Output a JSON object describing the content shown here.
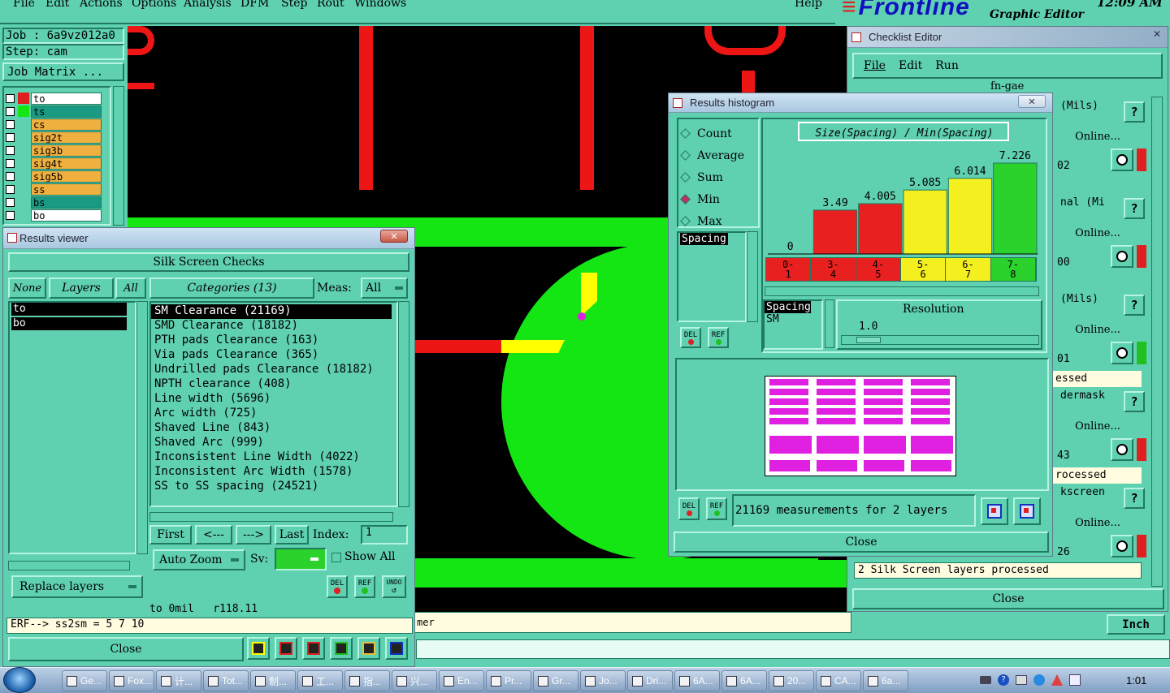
{
  "menubar": {
    "items": [
      "File",
      "Edit",
      "Actions",
      "Options",
      "Analysis",
      "DFM",
      "Step",
      "Rout",
      "Windows"
    ],
    "help": "Help"
  },
  "brand": {
    "name": "Frontline",
    "subtitle": "Graphic Editor",
    "clock": "12:09 AM"
  },
  "job": {
    "job_line": "Job : 6a9vz012a0",
    "step_line": "Step: cam",
    "matrix_button": "Job Matrix ..."
  },
  "layers": [
    {
      "name": "to",
      "color": "#ffffff"
    },
    {
      "name": "ts",
      "color": "#1a9a82"
    },
    {
      "name": "cs",
      "color": "#f0b040"
    },
    {
      "name": "sig2t",
      "color": "#f0b040"
    },
    {
      "name": "sig3b",
      "color": "#f0b040"
    },
    {
      "name": "sig4t",
      "color": "#f0b040"
    },
    {
      "name": "sig5b",
      "color": "#f0b040"
    },
    {
      "name": "ss",
      "color": "#f0b040"
    },
    {
      "name": "bs",
      "color": "#1a9a82"
    },
    {
      "name": "bo",
      "color": "#ffffff"
    }
  ],
  "results_viewer": {
    "title": "Results viewer",
    "header": "Silk Screen Checks",
    "none_button": "None",
    "layers_button": "Layers",
    "all_button": "All",
    "categories_button": "Categories (13)",
    "meas_label": "Meas:",
    "meas_value": "All",
    "layer_list": [
      "to",
      "bo"
    ],
    "categories": [
      "SM Clearance (21169)",
      "SMD Clearance (18182)",
      "PTH pads Clearance (163)",
      "Via pads Clearance (365)",
      "Undrilled pads Clearance (18182)",
      "NPTH clearance (408)",
      "Line width (5696)",
      "Arc width (725)",
      "Shaved Line (843)",
      "Shaved Arc (999)",
      "Inconsistent Line Width (4022)",
      "Inconsistent Arc Width (1578)",
      "SS to SS spacing (24521)"
    ],
    "nav": {
      "first": "First",
      "prev": "<---",
      "next": "--->",
      "last": "Last",
      "index_label": "Index:",
      "index_value": "1"
    },
    "auto_zoom": "Auto Zoom",
    "sv_label": "Sv:",
    "show_all": "Show All",
    "replace_layers": "Replace layers",
    "status_line": "to 0mil   r118.11",
    "erf_line": "ERF--> ss2sm = 5 7 10",
    "close": "Close",
    "del": "DEL",
    "ref": "REF",
    "undo": "UNDO"
  },
  "histogram": {
    "title": "Results histogram",
    "options": [
      "Count",
      "Average",
      "Sum",
      "Min",
      "Max"
    ],
    "selected_option": "Min",
    "chart_title": "Size(Spacing) / Min(Spacing)",
    "spacing_list_label": "Spacing",
    "spacing_box": {
      "top": "Spacing",
      "bottom": "SM"
    },
    "resolution_label": "Resolution",
    "resolution_value": "1.0",
    "summary": "21169 measurements for 2 layers",
    "close": "Close"
  },
  "chart_data": {
    "type": "bar",
    "title": "Size(Spacing) / Min(Spacing)",
    "categories": [
      "0-1",
      "3-4",
      "4-5",
      "5-6",
      "6-7",
      "7-8"
    ],
    "values": [
      0,
      3.49,
      4.005,
      5.085,
      6.014,
      7.226
    ],
    "value_labels": [
      "0",
      "3.49",
      "4.005",
      "5.085",
      "6.014",
      "7.226"
    ],
    "bar_colors": [
      "#e82020",
      "#e82020",
      "#e82020",
      "#f4f020",
      "#f4f020",
      "#2bd22b"
    ],
    "ylim": [
      0,
      8
    ]
  },
  "checklist": {
    "title": "Checklist Editor",
    "menu": [
      "File",
      "Edit",
      "Run"
    ],
    "name": "fn-gae",
    "rows": [
      {
        "label": "(Mils)",
        "online": "Online...",
        "status": "02",
        "flag": "red"
      },
      {
        "label": "nal (Mi",
        "online": "Online...",
        "status": "00",
        "flag": "red"
      },
      {
        "label": "(Mils)",
        "online": "Online...",
        "status": "01",
        "flag": "green"
      },
      {
        "label": "dermask",
        "online": "Online...",
        "status": "43",
        "flag": "red"
      },
      {
        "label": "kscreen",
        "online": "Online...",
        "status": "26",
        "flag": "red"
      }
    ],
    "row_texts": [
      "essed",
      "rocessed"
    ],
    "bottom_status": "2 Silk Screen layers processed",
    "close": "Close"
  },
  "bottom": {
    "fragment": "mer",
    "units": "Inch"
  },
  "taskbar": {
    "items": [
      "Ge...",
      "Fox...",
      "计...",
      "Tot...",
      "制...",
      "工...",
      "指...",
      "兴...",
      "En...",
      "Pr...",
      "Gr...",
      "Jo...",
      "Dri...",
      "6A...",
      "6A...",
      "20...",
      "CA...",
      "6a..."
    ],
    "time": "1:01"
  }
}
